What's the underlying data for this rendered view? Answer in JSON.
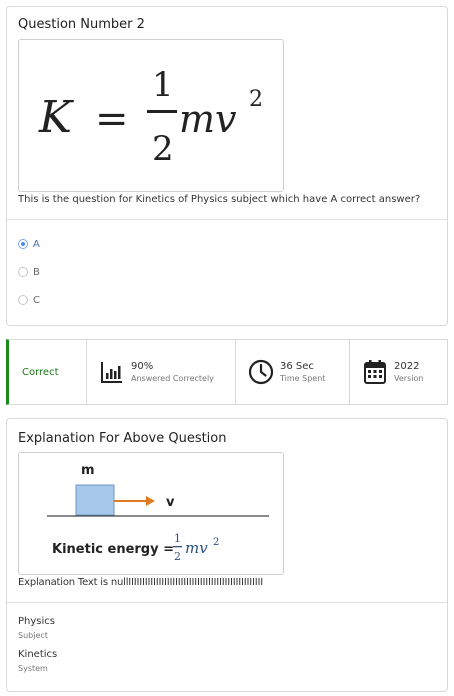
{
  "question": {
    "title": "Question Number 2",
    "text": "This is the question for Kinetics of Physics subject which have A correct answer?",
    "options": [
      {
        "label": "A",
        "selected": true
      },
      {
        "label": "B",
        "selected": false
      },
      {
        "label": "C",
        "selected": false
      }
    ]
  },
  "formula": {
    "lhs": "K",
    "equals": "=",
    "numerator": "1",
    "denominator": "2",
    "rhs": "mv",
    "exponent": "2"
  },
  "stats": {
    "result": "Correct",
    "percent": "90%",
    "percent_label": "Answered Correctely",
    "time": "36 Sec",
    "time_label": "Time Spent",
    "version": "2022",
    "version_label": "Version",
    "colors": {
      "correct": "#1a8a1a"
    }
  },
  "explanation": {
    "title": "Explanation For Above Question",
    "diagram": {
      "mass_label": "m",
      "velocity_label": "v",
      "energy_label": "Kinetic energy =",
      "numerator": "1",
      "denominator": "2",
      "rhs": "mv",
      "exponent": "2"
    },
    "text": "Explanation Text is nullIIIIIIIIIIIIIIIIIIIIIIIIIIIIIIIIIIIIIIIIIIIIIIIII"
  },
  "meta": [
    {
      "value": "Physics",
      "label": "Subject"
    },
    {
      "value": "Kinetics",
      "label": "System"
    }
  ]
}
